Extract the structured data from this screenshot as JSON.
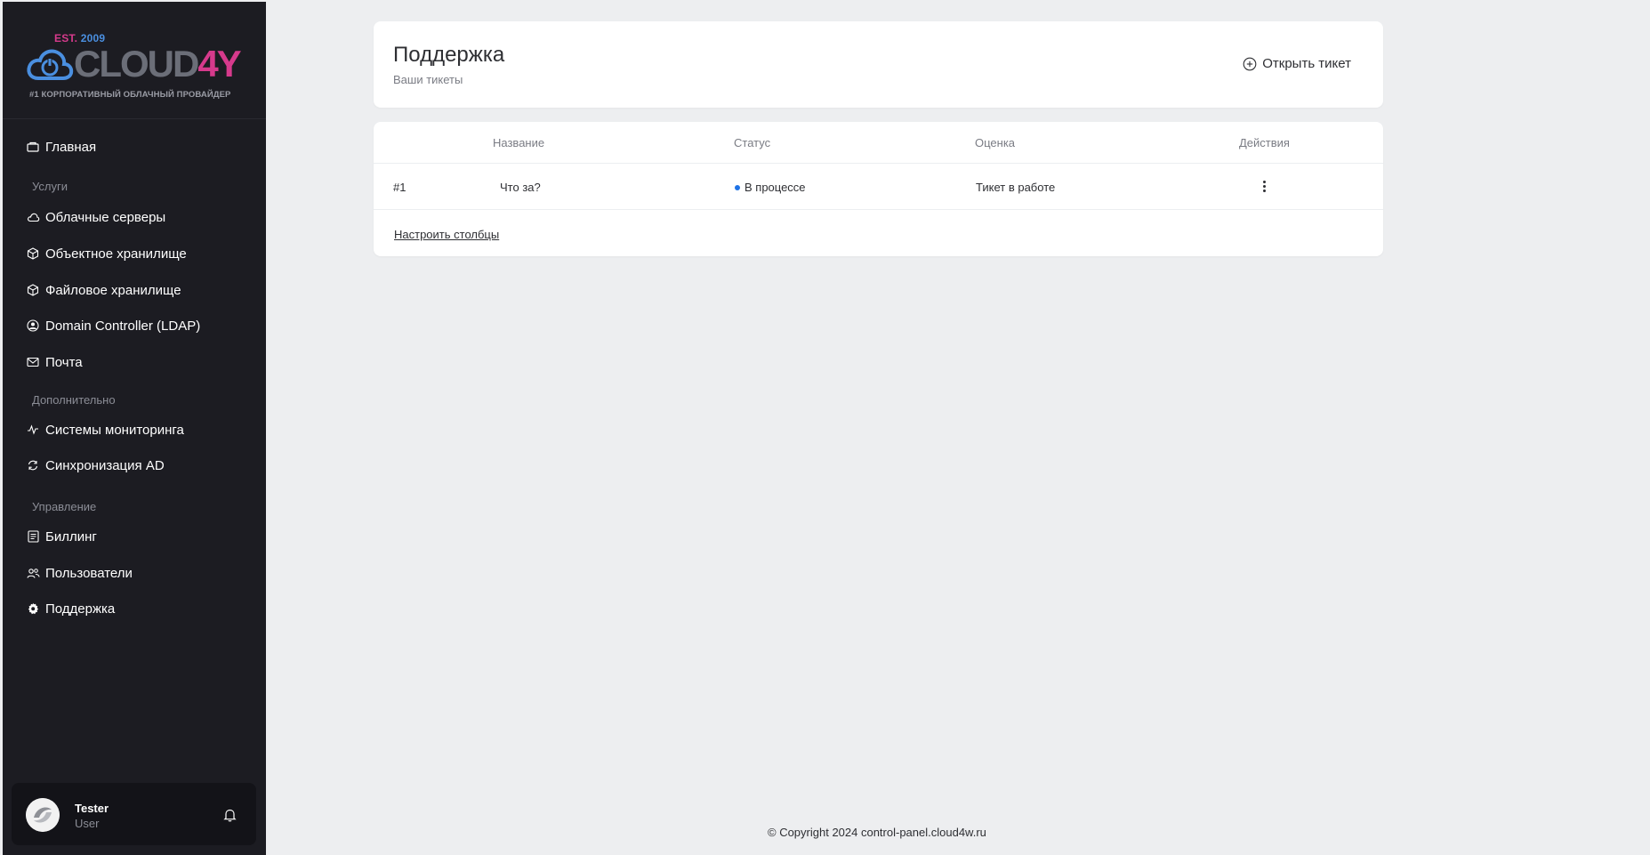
{
  "logo": {
    "est_prefix": "EST.",
    "est_year": "2009",
    "brand_main": "CLOUD",
    "brand_accent": "4Y",
    "tagline": "#1 КОРПОРАТИВНЫЙ ОБЛАЧНЫЙ ПРОВАЙДЕР"
  },
  "sidebar": {
    "home": {
      "label": "Главная",
      "icon": "briefcase-icon"
    },
    "sections": {
      "services": "Услуги",
      "additional": "Дополнительно",
      "management": "Управление"
    },
    "items": [
      {
        "label": "Облачные серверы",
        "icon": "cloud-icon"
      },
      {
        "label": "Объектное хранилище",
        "icon": "box-icon"
      },
      {
        "label": "Файловое хранилище",
        "icon": "box-icon"
      },
      {
        "label": "Domain Controller (LDAP)",
        "icon": "user-circle-icon"
      },
      {
        "label": "Почта",
        "icon": "mail-icon"
      },
      {
        "label": "Системы мониторинга",
        "icon": "activity-icon"
      },
      {
        "label": "Синхронизация AD",
        "icon": "sync-icon"
      },
      {
        "label": "Биллинг",
        "icon": "receipt-icon"
      },
      {
        "label": "Пользователи",
        "icon": "users-icon"
      },
      {
        "label": "Поддержка",
        "icon": "gear-icon"
      }
    ]
  },
  "user": {
    "name": "Tester",
    "role": "User"
  },
  "header": {
    "title": "Поддержка",
    "subtitle": "Ваши тикеты",
    "open_ticket_label": "Открыть тикет"
  },
  "table": {
    "columns": [
      "Название",
      "Статус",
      "Оценка",
      "Действия"
    ],
    "rows": [
      {
        "id": "#1",
        "name": "Что за?",
        "status": "В процессе",
        "rating": "Тикет в работе"
      }
    ],
    "configure_label": "Настроить столбцы"
  },
  "footer": {
    "copyright": "© Copyright 2024 control-panel.cloud4w.ru"
  },
  "colors": {
    "sidebar_bg": "#1c1c22",
    "accent_pink": "#d63a8c",
    "accent_blue": "#4a8fe0",
    "status_blue": "#1f73e6",
    "page_bg": "#edeef0"
  }
}
